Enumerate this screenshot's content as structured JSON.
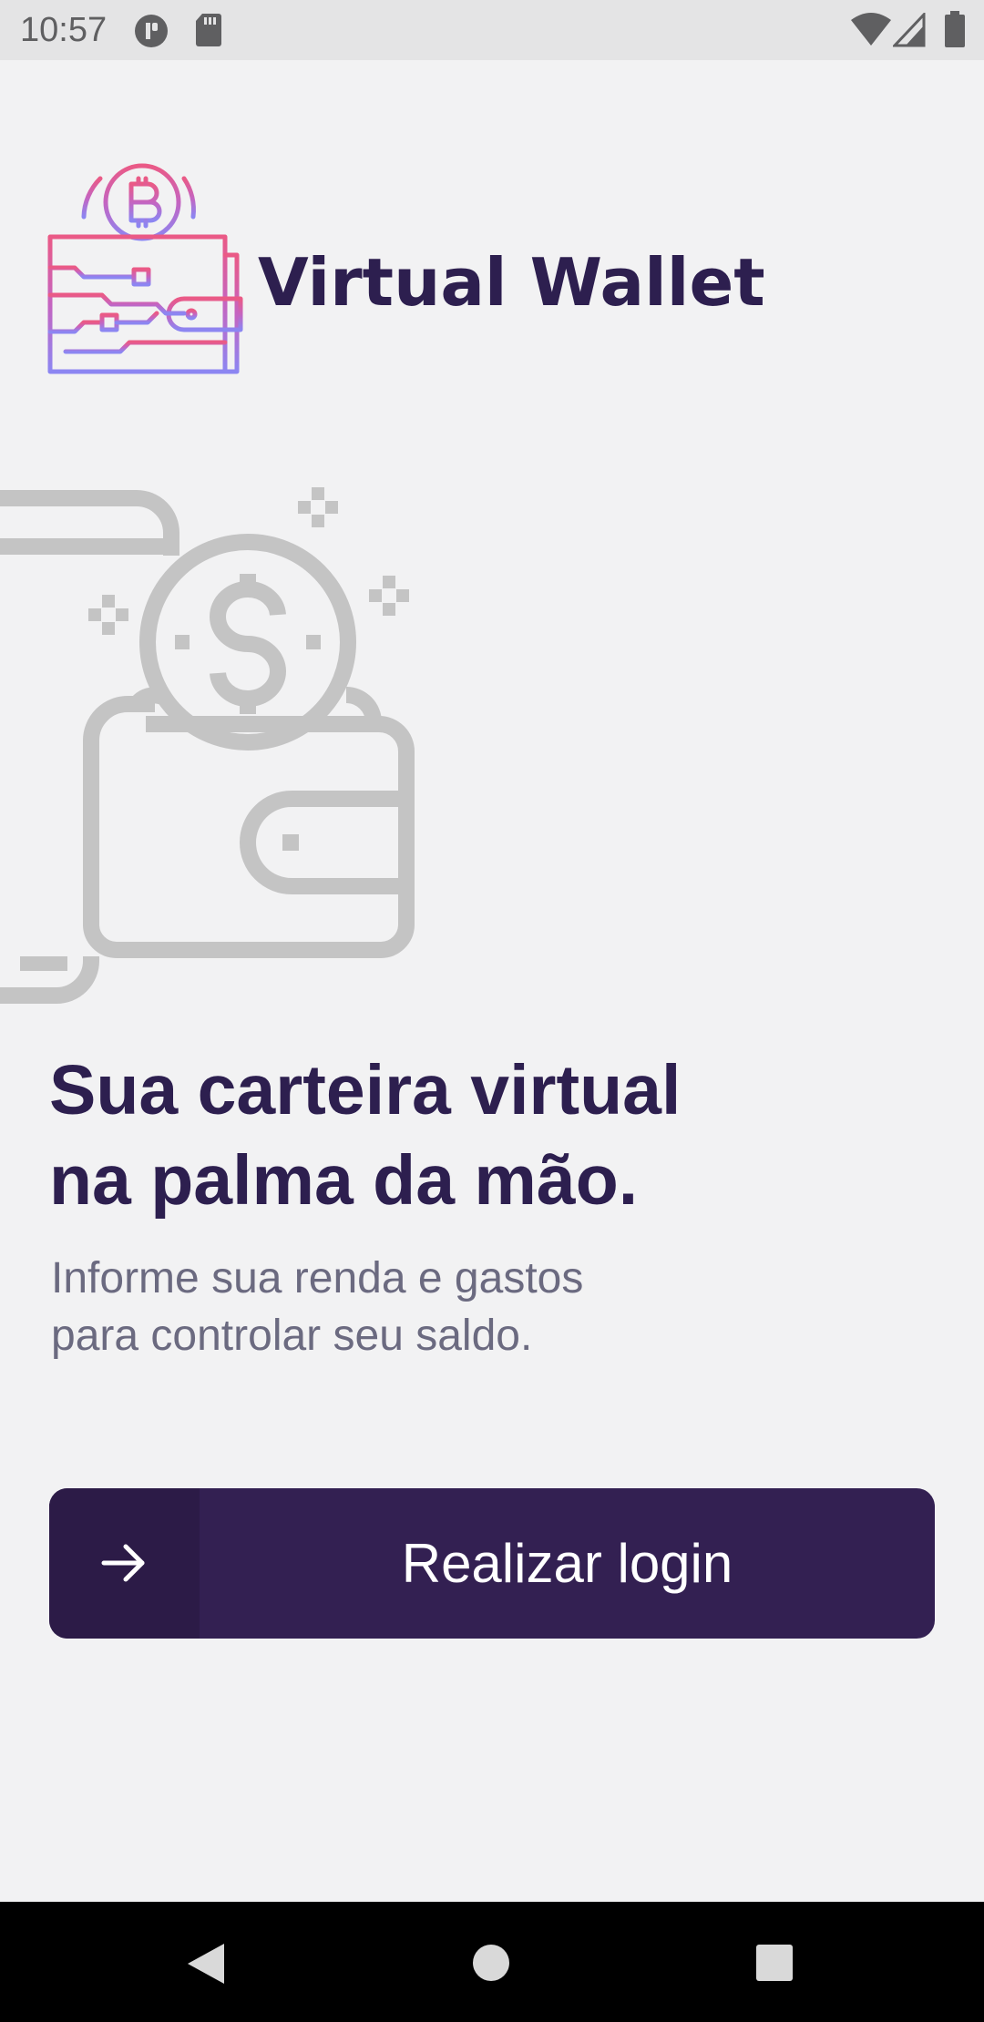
{
  "status_bar": {
    "time": "10:57",
    "left_icons": [
      "notification-app-icon",
      "sd-card-icon"
    ],
    "right_icons": [
      "wifi-icon",
      "cell-signal-icon",
      "battery-icon"
    ]
  },
  "brand": {
    "name": "Virtual Wallet",
    "logo_icon": "bitcoin-wallet-logo-icon",
    "logo_colors": {
      "top": "#e85a8a",
      "bottom": "#8b85f0"
    }
  },
  "illustration": {
    "icon": "wallet-coin-illustration-icon",
    "color": "#c4c4c4"
  },
  "headline": {
    "line1": "Sua carteira virtual",
    "line2": "na palma da mão."
  },
  "subtitle": {
    "line1": "Informe sua renda e gastos",
    "line2": "para controlar seu saldo."
  },
  "login_button": {
    "label": "Realizar login",
    "icon": "arrow-right-icon",
    "color": "#332052"
  },
  "nav_bar": {
    "buttons": [
      "back-icon",
      "home-icon",
      "recents-icon"
    ]
  },
  "colors": {
    "background": "#f2f2f3",
    "primary": "#2d1f4f",
    "subtitle": "#6b6a80"
  }
}
